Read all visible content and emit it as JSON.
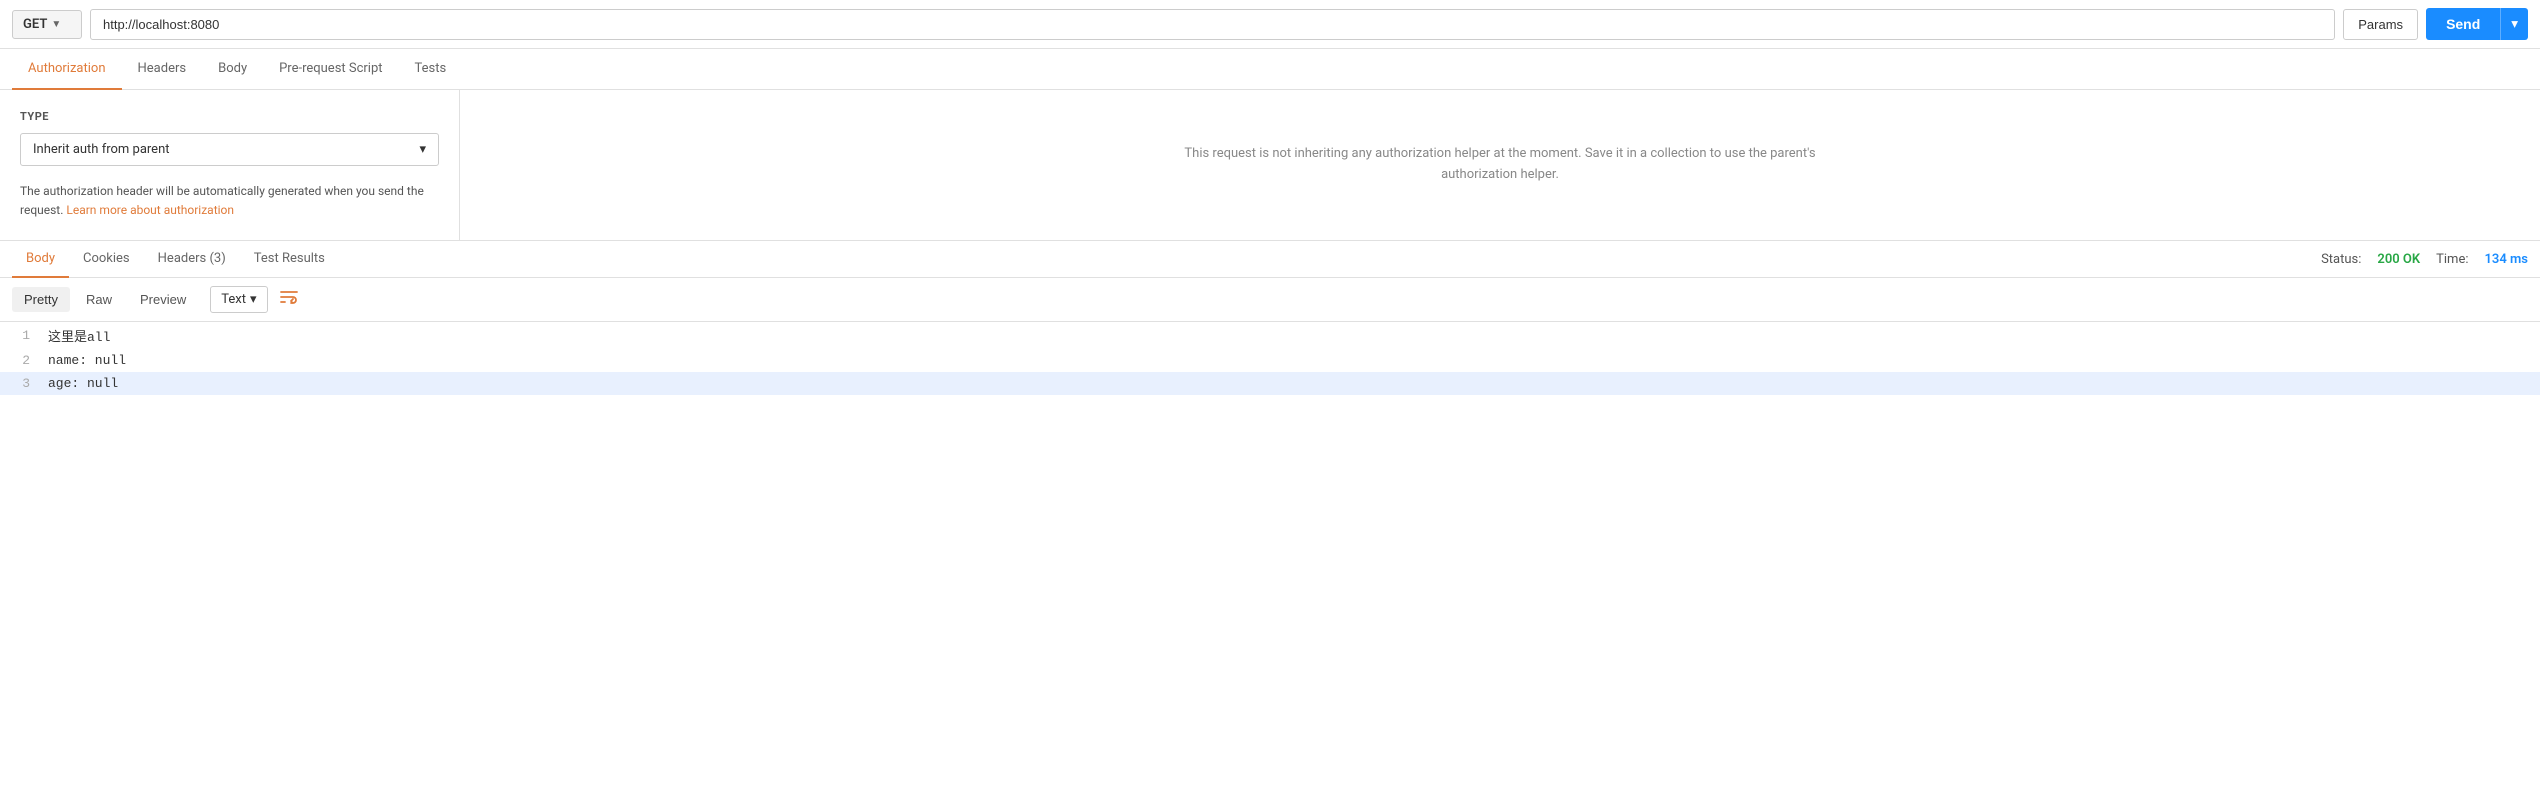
{
  "topbar": {
    "method": "GET",
    "method_chevron": "▼",
    "url": "http://localhost:8080",
    "params_label": "Params",
    "send_label": "Send",
    "send_dropdown_icon": "▾"
  },
  "request_tabs": [
    {
      "id": "authorization",
      "label": "Authorization",
      "active": true
    },
    {
      "id": "headers",
      "label": "Headers",
      "active": false
    },
    {
      "id": "body",
      "label": "Body",
      "active": false
    },
    {
      "id": "pre-request-script",
      "label": "Pre-request Script",
      "active": false
    },
    {
      "id": "tests",
      "label": "Tests",
      "active": false
    }
  ],
  "auth": {
    "type_label": "TYPE",
    "type_value": "Inherit auth from parent",
    "type_chevron": "▾",
    "note": "The authorization header will be automatically generated when you send the request.",
    "learn_more_text": "Learn more about authorization",
    "right_message": "This request is not inheriting any authorization helper at the moment. Save it in a collection to use the parent's authorization helper."
  },
  "response_tabs": [
    {
      "id": "body",
      "label": "Body",
      "active": true
    },
    {
      "id": "cookies",
      "label": "Cookies",
      "active": false
    },
    {
      "id": "headers",
      "label": "Headers (3)",
      "active": false
    },
    {
      "id": "test-results",
      "label": "Test Results",
      "active": false
    }
  ],
  "response_status": {
    "status_label": "Status:",
    "status_value": "200 OK",
    "time_label": "Time:",
    "time_value": "134 ms"
  },
  "body_format": {
    "pretty_label": "Pretty",
    "raw_label": "Raw",
    "preview_label": "Preview",
    "text_type_label": "Text",
    "text_type_chevron": "▾",
    "wrap_icon": "⇌"
  },
  "code_lines": [
    {
      "number": "1",
      "content": "这里是all"
    },
    {
      "number": "2",
      "content": "name: null"
    },
    {
      "number": "3",
      "content": "age: null"
    }
  ]
}
